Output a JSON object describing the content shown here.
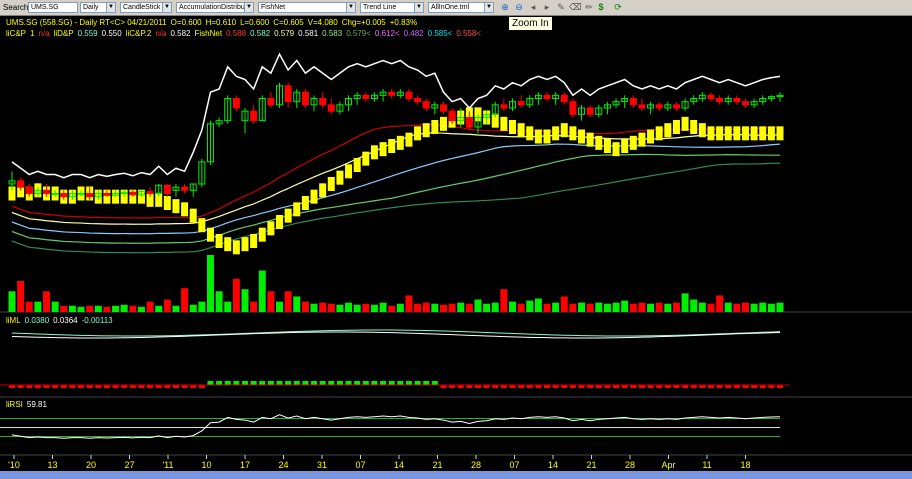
{
  "toolbar": {
    "search_label": "Search",
    "symbol": "UMS.SG",
    "period": "Daily",
    "chart_style": "CandleStick",
    "indicator": "AccumulationDistributi",
    "fishnet": "FishNet",
    "drawing": "Trend Line",
    "template": "AllInOne.tml"
  },
  "tooltip": "Zoom In",
  "header": {
    "line1": [
      {
        "text": "UMS.SG (558.SG) - Daily RT<C> 04/21/2011",
        "color": "#ffff00"
      },
      {
        "text": "O=0.600",
        "color": "#ffff00"
      },
      {
        "text": "H=0.610",
        "color": "#ffff00"
      },
      {
        "text": "L=0.600",
        "color": "#ffff00"
      },
      {
        "text": "C=0.605",
        "color": "#ffff00"
      },
      {
        "text": "V=4.080",
        "color": "#ffff00"
      },
      {
        "text": "Chg=+0.005",
        "color": "#ffff00"
      },
      {
        "text": "+0.83%",
        "color": "#ffff00"
      }
    ],
    "line2": [
      {
        "text": "liC&P",
        "color": "#ffff00"
      },
      {
        "text": "1",
        "color": "#ffff00"
      },
      {
        "text": "n/a",
        "color": "#ff3030"
      },
      {
        "text": "liD&P",
        "color": "#ffff00"
      },
      {
        "text": "0.559",
        "color": "#7fffd4"
      },
      {
        "text": "0.550",
        "color": "#ffffff"
      },
      {
        "text": "liC&P.2",
        "color": "#ffff00"
      },
      {
        "text": "n/a",
        "color": "#ff3030"
      },
      {
        "text": "0.582",
        "color": "#ffffff"
      },
      {
        "text": "FishNet",
        "color": "#ffff00"
      },
      {
        "text": "0.588",
        "color": "#ff3030"
      },
      {
        "text": "0.582",
        "color": "#7fffd4"
      },
      {
        "text": "0.579",
        "color": "#ffff99"
      },
      {
        "text": "0.581",
        "color": "#ffffff"
      },
      {
        "text": "0.583",
        "color": "#90ee90"
      },
      {
        "text": "0.579<",
        "color": "#66aa66"
      },
      {
        "text": "0.612<",
        "color": "#ff66ff"
      },
      {
        "text": "0.482",
        "color": "#cc66ff"
      },
      {
        "text": "0.585<",
        "color": "#00e5ee"
      },
      {
        "text": "0.558<",
        "color": "#ff5050"
      }
    ],
    "liml": [
      {
        "text": "liML",
        "color": "#ffff00"
      },
      {
        "text": "0.0380",
        "color": "#7fffd4"
      },
      {
        "text": "0.0364",
        "color": "#ffffff"
      },
      {
        "text": "-0.00113",
        "color": "#7fffd4"
      }
    ],
    "lirsi": [
      {
        "text": "liRSI",
        "color": "#ffff00"
      },
      {
        "text": "59.81",
        "color": "#ffffff"
      }
    ]
  },
  "colors": {
    "up": "#00ee00",
    "down": "#ff0000",
    "fishnet": "#ffff00",
    "white_line": "#ffffff",
    "dark_red_line": "#cc0000",
    "grid": "#2a2a2a"
  },
  "chart_data": {
    "type": "candlestick",
    "x_tick_labels": [
      "'10",
      "13",
      "20",
      "27",
      "'11",
      "10",
      "17",
      "24",
      "31",
      "07",
      "14",
      "21",
      "28",
      "07",
      "14",
      "21",
      "28",
      "Apr",
      "11",
      "18"
    ],
    "rsi_levels": [
      70,
      50,
      30
    ],
    "rsi_value": 59.81,
    "series": [
      {
        "name": "candles",
        "values": [
          [
            0.52,
            0.54,
            0.51,
            0.525
          ],
          [
            0.525,
            0.53,
            0.51,
            0.515
          ],
          [
            0.515,
            0.52,
            0.5,
            0.505
          ],
          [
            0.505,
            0.515,
            0.5,
            0.51
          ],
          [
            0.51,
            0.52,
            0.5,
            0.505
          ],
          [
            0.505,
            0.51,
            0.5,
            0.505
          ],
          [
            0.505,
            0.51,
            0.495,
            0.5
          ],
          [
            0.5,
            0.51,
            0.495,
            0.505
          ],
          [
            0.505,
            0.51,
            0.5,
            0.505
          ],
          [
            0.505,
            0.515,
            0.495,
            0.5
          ],
          [
            0.5,
            0.51,
            0.495,
            0.505
          ],
          [
            0.505,
            0.51,
            0.5,
            0.502
          ],
          [
            0.502,
            0.51,
            0.5,
            0.505
          ],
          [
            0.505,
            0.51,
            0.5,
            0.507
          ],
          [
            0.507,
            0.51,
            0.5,
            0.503
          ],
          [
            0.503,
            0.51,
            0.5,
            0.508
          ],
          [
            0.508,
            0.515,
            0.5,
            0.505
          ],
          [
            0.505,
            0.52,
            0.5,
            0.518
          ],
          [
            0.518,
            0.52,
            0.5,
            0.505
          ],
          [
            0.51,
            0.52,
            0.5,
            0.515
          ],
          [
            0.515,
            0.52,
            0.505,
            0.51
          ],
          [
            0.51,
            0.52,
            0.5,
            0.52
          ],
          [
            0.52,
            0.56,
            0.515,
            0.555
          ],
          [
            0.555,
            0.62,
            0.55,
            0.615
          ],
          [
            0.615,
            0.625,
            0.61,
            0.62
          ],
          [
            0.62,
            0.66,
            0.615,
            0.655
          ],
          [
            0.655,
            0.66,
            0.635,
            0.64
          ],
          [
            0.62,
            0.64,
            0.6,
            0.635
          ],
          [
            0.635,
            0.645,
            0.615,
            0.62
          ],
          [
            0.62,
            0.66,
            0.62,
            0.655
          ],
          [
            0.655,
            0.665,
            0.64,
            0.645
          ],
          [
            0.645,
            0.68,
            0.64,
            0.675
          ],
          [
            0.675,
            0.68,
            0.64,
            0.65
          ],
          [
            0.65,
            0.67,
            0.64,
            0.665
          ],
          [
            0.665,
            0.67,
            0.64,
            0.645
          ],
          [
            0.645,
            0.66,
            0.635,
            0.655
          ],
          [
            0.655,
            0.665,
            0.64,
            0.645
          ],
          [
            0.645,
            0.655,
            0.63,
            0.635
          ],
          [
            0.635,
            0.65,
            0.63,
            0.645
          ],
          [
            0.645,
            0.66,
            0.635,
            0.655
          ],
          [
            0.655,
            0.665,
            0.645,
            0.66
          ],
          [
            0.66,
            0.665,
            0.65,
            0.655
          ],
          [
            0.655,
            0.665,
            0.65,
            0.66
          ],
          [
            0.66,
            0.67,
            0.65,
            0.665
          ],
          [
            0.665,
            0.67,
            0.655,
            0.66
          ],
          [
            0.66,
            0.67,
            0.655,
            0.665
          ],
          [
            0.665,
            0.67,
            0.65,
            0.655
          ],
          [
            0.655,
            0.66,
            0.645,
            0.65
          ],
          [
            0.65,
            0.655,
            0.635,
            0.64
          ],
          [
            0.64,
            0.65,
            0.63,
            0.645
          ],
          [
            0.645,
            0.65,
            0.63,
            0.635
          ],
          [
            0.635,
            0.64,
            0.615,
            0.62
          ],
          [
            0.62,
            0.64,
            0.61,
            0.625
          ],
          [
            0.625,
            0.635,
            0.605,
            0.61
          ],
          [
            0.61,
            0.63,
            0.6,
            0.625
          ],
          [
            0.625,
            0.635,
            0.615,
            0.63
          ],
          [
            0.63,
            0.65,
            0.625,
            0.645
          ],
          [
            0.645,
            0.655,
            0.635,
            0.64
          ],
          [
            0.64,
            0.655,
            0.635,
            0.65
          ],
          [
            0.65,
            0.66,
            0.64,
            0.645
          ],
          [
            0.645,
            0.66,
            0.64,
            0.655
          ],
          [
            0.655,
            0.665,
            0.645,
            0.66
          ],
          [
            0.66,
            0.665,
            0.65,
            0.655
          ],
          [
            0.655,
            0.665,
            0.645,
            0.66
          ],
          [
            0.66,
            0.665,
            0.645,
            0.65
          ],
          [
            0.65,
            0.655,
            0.625,
            0.63
          ],
          [
            0.63,
            0.645,
            0.62,
            0.64
          ],
          [
            0.64,
            0.645,
            0.625,
            0.63
          ],
          [
            0.63,
            0.645,
            0.625,
            0.64
          ],
          [
            0.64,
            0.65,
            0.63,
            0.645
          ],
          [
            0.645,
            0.655,
            0.64,
            0.65
          ],
          [
            0.65,
            0.66,
            0.64,
            0.655
          ],
          [
            0.655,
            0.66,
            0.64,
            0.645
          ],
          [
            0.645,
            0.655,
            0.635,
            0.64
          ],
          [
            0.64,
            0.65,
            0.63,
            0.645
          ],
          [
            0.645,
            0.65,
            0.635,
            0.64
          ],
          [
            0.64,
            0.65,
            0.635,
            0.645
          ],
          [
            0.645,
            0.65,
            0.635,
            0.64
          ],
          [
            0.64,
            0.655,
            0.635,
            0.65
          ],
          [
            0.65,
            0.66,
            0.645,
            0.655
          ],
          [
            0.655,
            0.665,
            0.65,
            0.66
          ],
          [
            0.66,
            0.665,
            0.65,
            0.655
          ],
          [
            0.655,
            0.66,
            0.645,
            0.65
          ],
          [
            0.65,
            0.66,
            0.645,
            0.655
          ],
          [
            0.655,
            0.66,
            0.645,
            0.65
          ],
          [
            0.65,
            0.655,
            0.64,
            0.645
          ],
          [
            0.645,
            0.655,
            0.64,
            0.65
          ],
          [
            0.65,
            0.66,
            0.645,
            0.655
          ],
          [
            0.655,
            0.66,
            0.65,
            0.658
          ],
          [
            0.658,
            0.665,
            0.65,
            0.66
          ]
        ]
      },
      {
        "name": "volume",
        "values": [
          2,
          3,
          1,
          1,
          2,
          1,
          0.6,
          0.6,
          0.5,
          0.6,
          0.6,
          0.5,
          0.6,
          0.7,
          0.6,
          0.5,
          1,
          0.6,
          1.2,
          0.6,
          2.3,
          0.7,
          1,
          5.5,
          2,
          1,
          3.2,
          2.2,
          1,
          4,
          2,
          1,
          2,
          1.5,
          1,
          0.8,
          0.9,
          0.8,
          0.7,
          0.9,
          0.7,
          0.8,
          0.7,
          0.9,
          0.6,
          0.8,
          1.6,
          0.8,
          0.9,
          0.8,
          0.7,
          0.8,
          0.9,
          0.8,
          1.2,
          0.8,
          0.9,
          2.2,
          1,
          0.8,
          1.1,
          1.3,
          0.8,
          0.9,
          1.5,
          0.8,
          0.9,
          0.8,
          0.9,
          0.8,
          0.9,
          1.1,
          0.8,
          0.9,
          0.8,
          0.9,
          0.8,
          0.9,
          1.8,
          1.2,
          0.9,
          0.8,
          1.6,
          0.9,
          0.8,
          0.9,
          0.8,
          0.9,
          0.8,
          0.9
        ]
      },
      {
        "name": "fishnet_bars",
        "values": [
          0.505,
          0.51,
          0.505,
          0.51,
          0.505,
          0.505,
          0.5,
          0.5,
          0.505,
          0.505,
          0.5,
          0.5,
          0.5,
          0.5,
          0.5,
          0.5,
          0.495,
          0.495,
          0.49,
          0.485,
          0.48,
          0.47,
          0.455,
          0.44,
          0.43,
          0.425,
          0.42,
          0.425,
          0.43,
          0.44,
          0.45,
          0.46,
          0.47,
          0.48,
          0.49,
          0.5,
          0.51,
          0.52,
          0.53,
          0.54,
          0.55,
          0.56,
          0.57,
          0.575,
          0.58,
          0.585,
          0.59,
          0.6,
          0.605,
          0.61,
          0.615,
          0.62,
          0.625,
          0.63,
          0.63,
          0.625,
          0.62,
          0.615,
          0.61,
          0.605,
          0.6,
          0.595,
          0.595,
          0.6,
          0.605,
          0.6,
          0.595,
          0.59,
          0.585,
          0.58,
          0.575,
          0.58,
          0.585,
          0.59,
          0.595,
          0.6,
          0.605,
          0.61,
          0.615,
          0.61,
          0.605,
          0.6,
          0.6,
          0.6,
          0.6,
          0.6,
          0.6,
          0.6,
          0.6,
          0.6
        ]
      }
    ]
  }
}
